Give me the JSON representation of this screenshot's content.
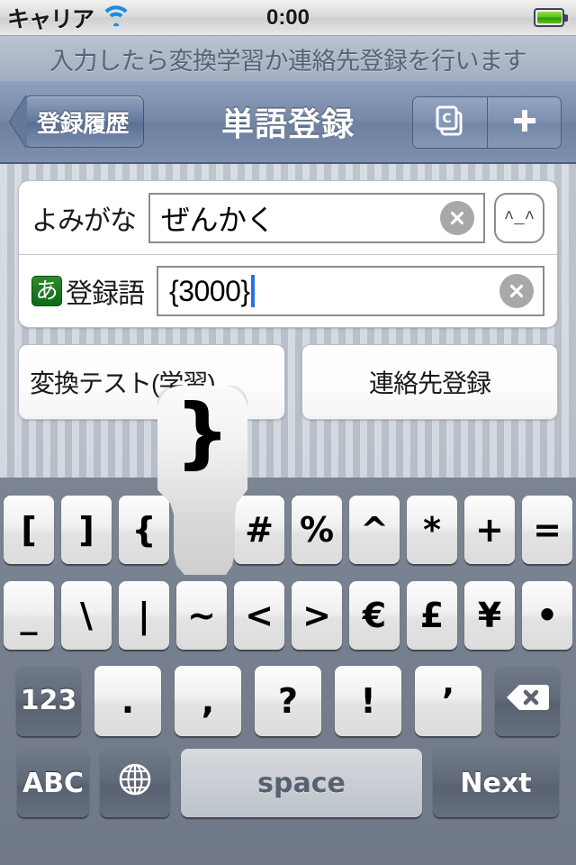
{
  "status_bar": {
    "carrier": "キャリア",
    "wifi_icon": "wifi-icon",
    "time": "0:00",
    "battery_icon": "battery-full-icon"
  },
  "hint_bar": {
    "text": "入力したら変換学習か連絡先登録を行います"
  },
  "nav_bar": {
    "back_label": "登録履歴",
    "title": "単語登録",
    "segments": [
      {
        "icon": "copy-documents-icon",
        "name": "copy-button"
      },
      {
        "icon": "plus-icon",
        "name": "add-button"
      }
    ]
  },
  "form": {
    "reading_row": {
      "label": "よみがな",
      "value": "ぜんかく",
      "placeholder": "",
      "clear_icon": "clear-circle-icon",
      "emoticon_label": "^_^"
    },
    "word_row": {
      "ime_badge": "あ",
      "label": "登録語",
      "value": "{3000}",
      "placeholder": "",
      "clear_icon": "clear-circle-icon",
      "has_caret": true
    }
  },
  "actions": {
    "convert_test": "変換テスト(学習)",
    "contact_register": "連絡先登録"
  },
  "key_popup": {
    "glyph": "}"
  },
  "keyboard": {
    "row1": [
      "[",
      "]",
      "{",
      "}",
      "#",
      "%",
      "^",
      "*",
      "+",
      "="
    ],
    "row2": [
      "_",
      "\\",
      "|",
      "~",
      "<",
      ">",
      "€",
      "£",
      "¥",
      "•"
    ],
    "row3": {
      "numeric_label": "123",
      "keys": [
        ".",
        ",",
        "?",
        "!",
        "’"
      ],
      "delete_icon": "backspace-delete-icon"
    },
    "row4": {
      "abc_label": "ABC",
      "globe_icon": "globe-icon",
      "space_label": "space",
      "return_label": "Next"
    }
  },
  "colors": {
    "nav_blue": "#7688a6",
    "accent_caret": "#2b6fe8",
    "battery_green": "#5cc21e",
    "ime_green": "#0d6b17",
    "keyboard_bg": "#737c8b"
  }
}
